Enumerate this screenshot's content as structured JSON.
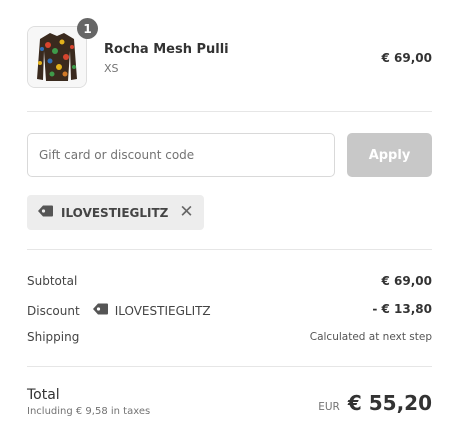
{
  "product": {
    "quantity_badge": "1",
    "name": "Rocha Mesh Pulli",
    "variant": "XS",
    "price": "€ 69,00",
    "thumbnail_icon": "shirt-image"
  },
  "discount_form": {
    "placeholder": "Gift card or discount code",
    "value": "",
    "apply_label": "Apply"
  },
  "applied_code": {
    "icon": "tag-icon",
    "code": "ILOVESTIEGLITZ",
    "remove_icon": "close-icon"
  },
  "summary": {
    "subtotal_label": "Subtotal",
    "subtotal_value": "€ 69,00",
    "discount_label": "Discount",
    "discount_code": "ILOVESTIEGLITZ",
    "discount_value": "- € 13,80",
    "shipping_label": "Shipping",
    "shipping_value": "Calculated at next step"
  },
  "total": {
    "label": "Total",
    "tax_note": "Including € 9,58 in taxes",
    "currency": "EUR",
    "amount": "€ 55,20"
  },
  "colors": {
    "badge": "#666666",
    "apply_disabled": "#c8c8c8",
    "tag_bg": "#ededed"
  }
}
